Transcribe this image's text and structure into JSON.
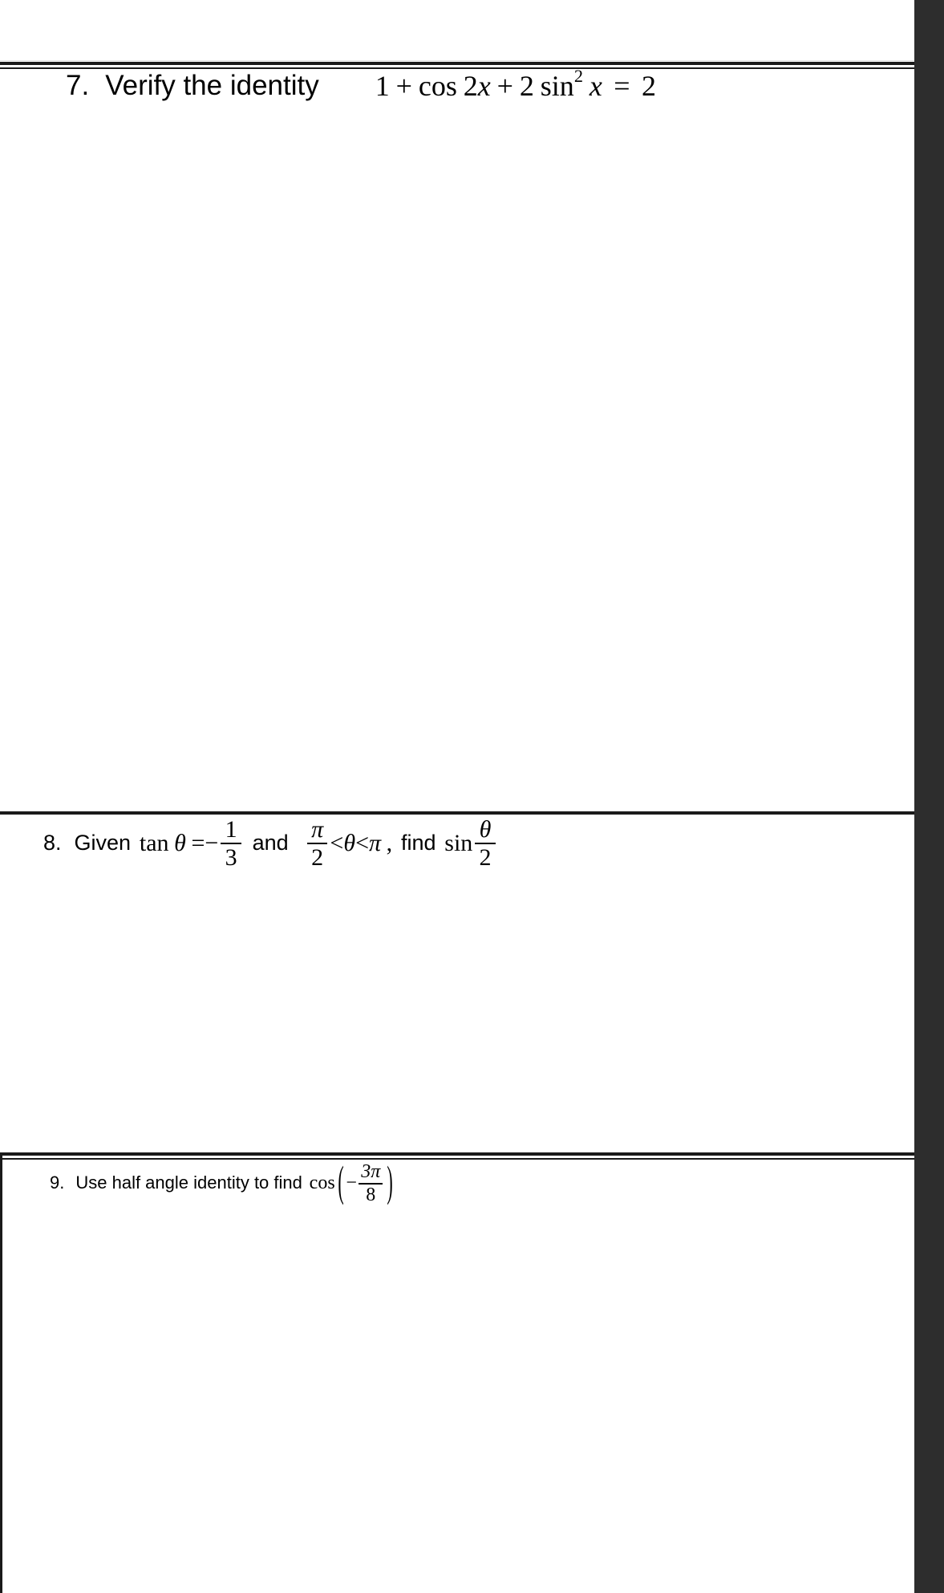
{
  "document": {
    "type": "math-worksheet",
    "page_background": "#ffffff",
    "gutter_color": "#2d2d2d",
    "rule_color": "#1a1a1a"
  },
  "problems": [
    {
      "number": "7.",
      "prompt": "Verify the identity",
      "equation": {
        "plain": "1 + cos 2x + 2 sin^2 x = 2",
        "tokens": {
          "one": "1",
          "plus1": "+",
          "cos": "cos",
          "two_x": "2",
          "x1": "x",
          "plus2": "+",
          "two2": "2",
          "sin": "sin",
          "exponent": "2",
          "x2": "x",
          "equals": "=",
          "rhs": "2"
        }
      }
    },
    {
      "number": "8.",
      "prompt": "Given",
      "prompt2": "and",
      "prompt3": "find",
      "equation": {
        "plain": "tan θ = -1/3 and π/2 < θ < π , find sin θ/2",
        "tokens": {
          "tan": "tan",
          "theta1": "θ",
          "equals": "=",
          "minus": "−",
          "frac1_num": "1",
          "frac1_den": "3",
          "frac2_num": "π",
          "frac2_den": "2",
          "lt1": "<",
          "theta2": "θ",
          "lt2": "<",
          "pi": "π",
          "comma": ",",
          "sin": "sin",
          "frac3_num": "θ",
          "frac3_den": "2"
        }
      }
    },
    {
      "number": "9.",
      "prompt": "Use half angle identity to find",
      "equation": {
        "plain": "cos(-3π/8)",
        "tokens": {
          "cos": "cos",
          "paren_left": "(",
          "minus": "−",
          "frac_num": "3π",
          "frac_den": "8",
          "paren_right": ")"
        }
      }
    }
  ]
}
